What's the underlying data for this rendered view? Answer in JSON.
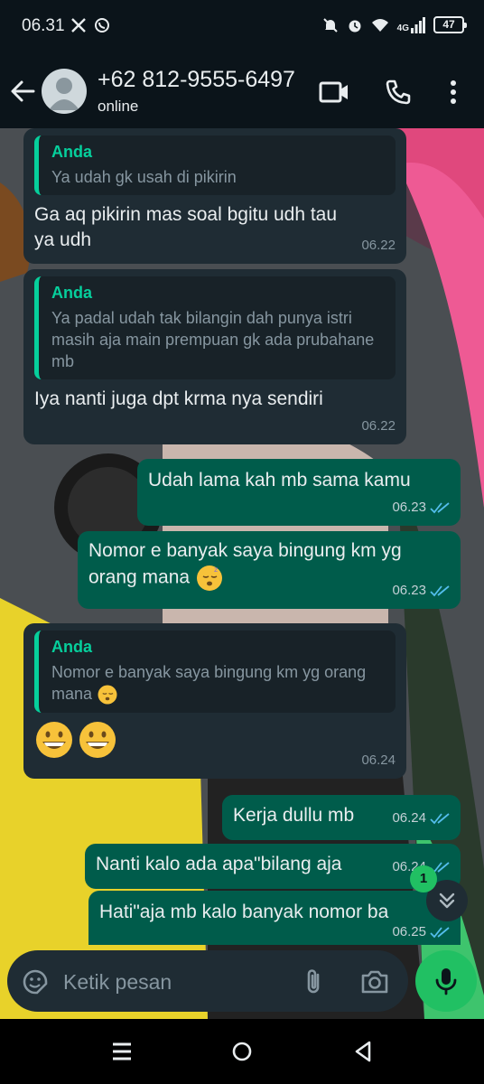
{
  "status_bar": {
    "time": "06.31",
    "left_icons": [
      "x-icon",
      "whatsapp-icon"
    ],
    "right_icons": [
      "mute-icon",
      "alarm-icon",
      "wifi-icon",
      "signal-icon"
    ],
    "network": "4G",
    "battery": "47"
  },
  "header": {
    "contact_name": "+62 812-9555-6497",
    "status": "online",
    "icons": [
      "back-arrow-icon",
      "avatar",
      "video-call-icon",
      "voice-call-icon",
      "more-options-icon"
    ]
  },
  "messages": [
    {
      "direction": "in",
      "quote_author": "Anda",
      "quote_text": "Ya udah gk usah di pikirin",
      "text": "Ga aq pikirin mas soal bgitu udh tau\nya udh",
      "time": "06.22"
    },
    {
      "direction": "in",
      "quote_author": "Anda",
      "quote_text": "Ya padal udah tak bilangin dah punya istri masih aja main prempuan gk ada prubahane mb",
      "text": "Iya nanti juga dpt krma nya sendiri",
      "time": "06.22"
    },
    {
      "direction": "out",
      "text": "Udah lama kah mb sama kamu",
      "time": "06.23",
      "status": "read"
    },
    {
      "direction": "out",
      "text": "Nomor e banyak saya bingung km yg orang mana",
      "emoji": "sleeping-face",
      "time": "06.23",
      "status": "read"
    },
    {
      "direction": "in",
      "quote_author": "Anda",
      "quote_text": "Nomor e banyak saya bingung km yg orang mana",
      "quote_emoji": "sleeping-face",
      "emojis": [
        "grinning-face",
        "grinning-face"
      ],
      "time": "06.24"
    },
    {
      "direction": "out",
      "text": "Kerja dullu mb",
      "time": "06.24",
      "status": "read"
    },
    {
      "direction": "out",
      "text": "Nanti kalo ada apa\"bilang aja",
      "time": "06.24",
      "status": "read"
    },
    {
      "direction": "out",
      "text": "Hati\"aja mb kalo banyak nomor ba",
      "time": "06.25",
      "status": "read"
    }
  ],
  "scroll_down": {
    "unread_count": "1"
  },
  "composer": {
    "placeholder": "Ketik pesan",
    "icons": [
      "sticker-icon",
      "attach-icon",
      "camera-icon",
      "mic-icon"
    ]
  },
  "nav_bar": {
    "icons": [
      "recents-icon",
      "home-icon",
      "back-icon"
    ]
  },
  "colors": {
    "background": "#0b141a",
    "incoming_bubble": "#1f2c34",
    "outgoing_bubble": "#005c4b",
    "accent": "#06cf9c",
    "read_ticks": "#53bdeb",
    "mic_button": "#21c063"
  }
}
